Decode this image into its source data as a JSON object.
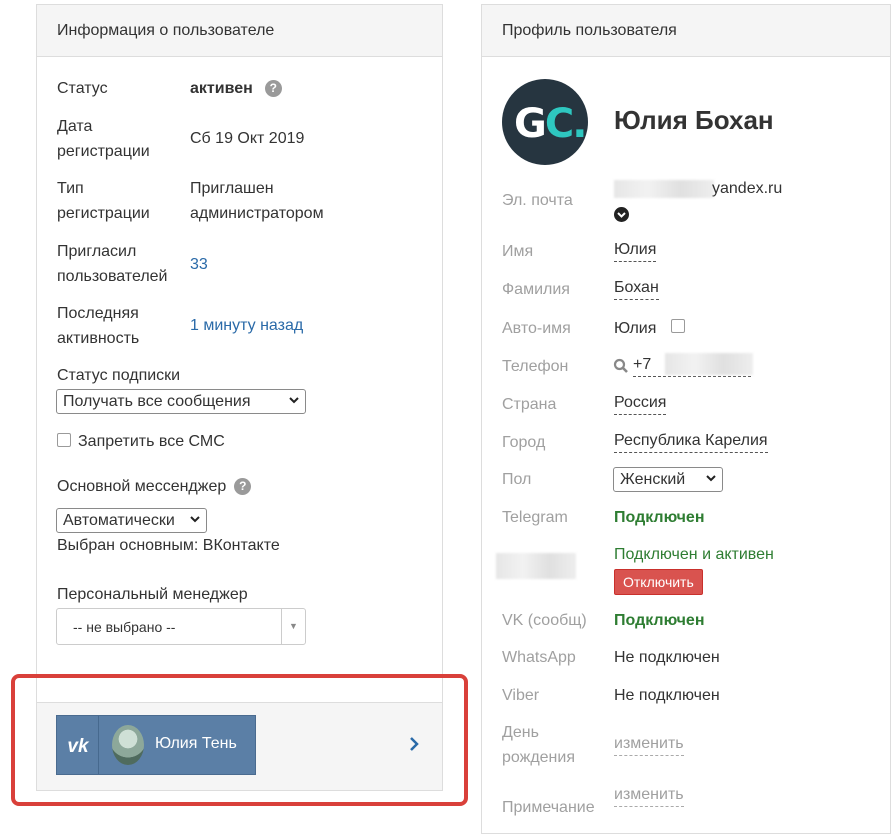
{
  "left_panel": {
    "title": "Информация о пользователе",
    "status": {
      "label": "Статус",
      "value": "активен"
    },
    "reg_date": {
      "label_1": "Дата",
      "label_2": "регистрации",
      "value": "Сб 19 Окт 2019"
    },
    "reg_type": {
      "label_1": "Тип",
      "label_2": "регистрации",
      "value_1": "Приглашен",
      "value_2": "администратором"
    },
    "invited": {
      "label_1": "Пригласил",
      "label_2": "пользователей",
      "value": "33"
    },
    "last_activity": {
      "label_1": "Последняя",
      "label_2": "активность",
      "value": "1 минуту назад"
    },
    "subscription": {
      "label": "Статус подписки",
      "selected": "Получать все сообщения"
    },
    "block_sms": {
      "label": "Запретить все СМС",
      "checked": false
    },
    "messenger": {
      "label": "Основной мессенджер",
      "selected": "Автоматически",
      "note": "Выбран основным: ВКонтакте"
    },
    "manager": {
      "label": "Персональный менеджер",
      "placeholder": "-- не выбрано --"
    },
    "footer_card": {
      "network": "vk",
      "name": "Юлия Тень"
    }
  },
  "right_panel": {
    "title": "Профиль пользователя",
    "avatar": {
      "letters_1": "G",
      "letters_2": "C",
      "dot": "."
    },
    "name": "Юлия Бохан",
    "fields": {
      "email": {
        "label": "Эл. почта",
        "value": "yandex.ru"
      },
      "first_name": {
        "label": "Имя",
        "value": "Юлия"
      },
      "last_name": {
        "label": "Фамилия",
        "value": "Бохан"
      },
      "auto_name": {
        "label": "Авто-имя",
        "value": "Юлия"
      },
      "phone": {
        "label": "Телефон",
        "value": "+7"
      },
      "country": {
        "label": "Страна",
        "value": "Россия"
      },
      "city": {
        "label": "Город",
        "value": "Республика Карелия"
      },
      "gender": {
        "label": "Пол",
        "selected": "Женский"
      },
      "telegram": {
        "label": "Telegram",
        "value": "Подключен"
      },
      "hidden_channel": {
        "value": "Подключен и активен",
        "button": "Отключить"
      },
      "vk": {
        "label": "VK (сообщ)",
        "value": "Подключен"
      },
      "whatsapp": {
        "label": "WhatsApp",
        "value": "Не подключен"
      },
      "viber": {
        "label": "Viber",
        "value": "Не подключен"
      },
      "birthday": {
        "label_1": "День",
        "label_2": "рождения",
        "value": "изменить"
      },
      "note": {
        "label": "Примечание",
        "value": "изменить"
      }
    }
  },
  "colors": {
    "accent_link": "#2a6aa8",
    "connected_green": "#2e7d32",
    "danger": "#d9534f",
    "vk_card": "#5b7fa6",
    "highlight": "#d9403a"
  }
}
